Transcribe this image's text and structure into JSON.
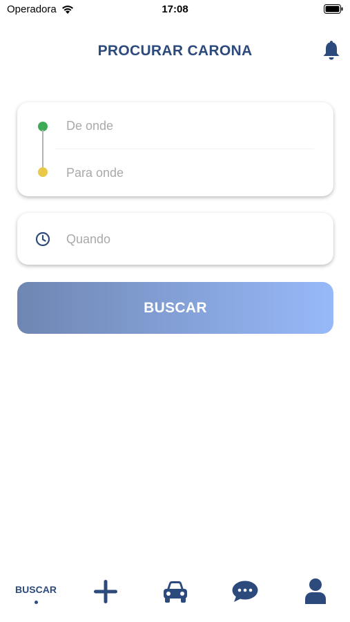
{
  "status_bar": {
    "carrier": "Operadora",
    "time": "17:08"
  },
  "header": {
    "title": "PROCURAR CARONA"
  },
  "route": {
    "from_placeholder": "De onde",
    "to_placeholder": "Para onde"
  },
  "when": {
    "placeholder": "Quando"
  },
  "search_button": {
    "label": "BUSCAR"
  },
  "tab_bar": {
    "active": "search",
    "items": [
      {
        "id": "search",
        "label": "BUSCAR",
        "icon": "search-tab-label"
      },
      {
        "id": "offer",
        "icon": "plus-icon"
      },
      {
        "id": "rides",
        "icon": "car-icon"
      },
      {
        "id": "messages",
        "icon": "chat-bubble-icon"
      },
      {
        "id": "profile",
        "icon": "user-icon"
      }
    ]
  },
  "colors": {
    "primary": "#2d4a7c",
    "origin_dot": "#3dab55",
    "destination_dot": "#e8c94a",
    "button_gradient_start": "#6f86b2",
    "button_gradient_end": "#97b9f9",
    "placeholder": "#a9a9a9"
  }
}
